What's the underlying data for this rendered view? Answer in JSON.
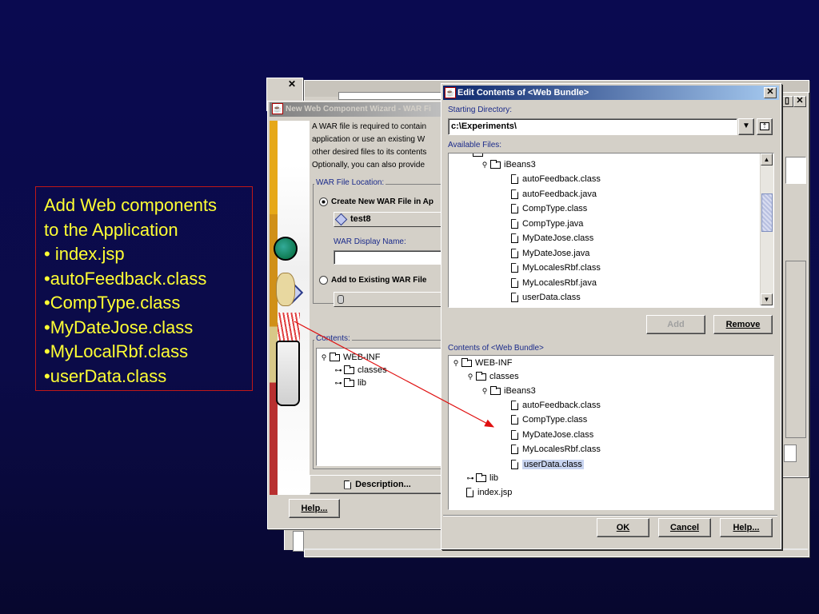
{
  "callout": {
    "lines": [
      "Add Web components",
      "to the Application",
      "• index.jsp",
      "•autoFeedback.class",
      "•CompType.class",
      "•MyDateJose.class",
      "•MyLocalRbf.class",
      "•userData.class"
    ],
    "border_color": "#c01818",
    "text_color": "#ffff33"
  },
  "wizard": {
    "title": "New Web Component Wizard - WAR Fi",
    "description_lines": [
      "A WAR file is required to contain",
      "application or use an existing W",
      "other desired files to its contents",
      "Optionally, you can also provide"
    ],
    "war_location_label": "WAR File Location:",
    "create_new_label": "Create New WAR File in Ap",
    "war_name_value": "test8",
    "war_display_name_label": "WAR Display Name:",
    "add_existing_label": "Add to Existing WAR File",
    "contents_label": "Contents:",
    "contents_tree": [
      "WEB-INF",
      "classes",
      "lib"
    ],
    "description_button": "Description...",
    "help_button": "Help..."
  },
  "dialog": {
    "title": "Edit Contents of <Web Bundle>",
    "starting_directory_label": "Starting Directory:",
    "starting_directory_value": "c:\\Experiments\\",
    "available_files_label": "Available Files:",
    "available_tree": {
      "folder": "iBeans3",
      "files": [
        "autoFeedback.class",
        "autoFeedback.java",
        "CompType.class",
        "CompType.java",
        "MyDateJose.class",
        "MyDateJose.java",
        "MyLocalesRbf.class",
        "MyLocalesRbf.java",
        "userData.class"
      ]
    },
    "add_button": "Add",
    "remove_button": "Remove",
    "contents_label": "Contents of <Web Bundle>",
    "contents_tree": {
      "root": "WEB-INF",
      "classes": "classes",
      "package": "iBeans3",
      "files": [
        "autoFeedback.class",
        "CompType.class",
        "MyDateJose.class",
        "MyLocalesRbf.class",
        "userData.class"
      ],
      "lib": "lib",
      "index": "index.jsp"
    },
    "ok_button": "OK",
    "cancel_button": "Cancel",
    "help_button": "Help..."
  },
  "icons": {
    "folder": "folder-icon",
    "file": "file-icon",
    "expand": "tree-expand-icon",
    "collapse": "tree-collapse-icon",
    "close": "close-icon",
    "dropdown": "chevron-down-icon",
    "up_folder": "up-folder-icon",
    "java_cup": "java-app-icon"
  },
  "colors": {
    "background": "#0b0b48",
    "titlebar": "#0a246a",
    "label_blue": "#1a2a8a",
    "selection": "#c8d4f0",
    "arrow": "#e01010"
  }
}
